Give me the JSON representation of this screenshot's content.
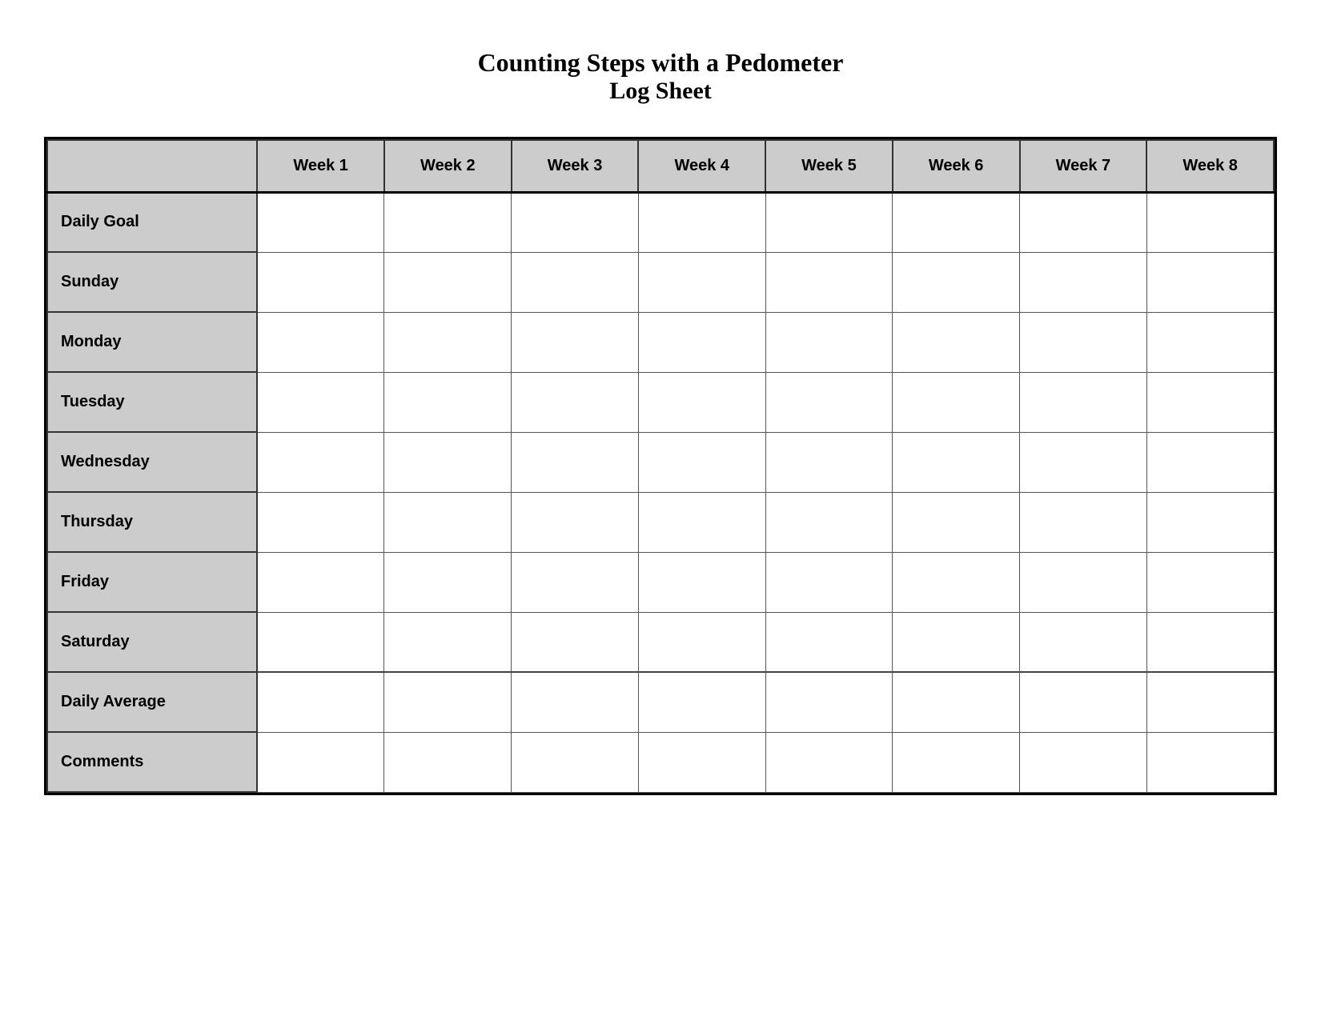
{
  "title": {
    "main": "Counting Steps with a Pedometer",
    "sub": "Log Sheet"
  },
  "header": {
    "corner_label": "",
    "weeks": [
      "Week 1",
      "Week 2",
      "Week 3",
      "Week 4",
      "Week 5",
      "Week 6",
      "Week 7",
      "Week 8"
    ]
  },
  "rows": [
    {
      "label": "Daily Goal"
    },
    {
      "label": "Sunday"
    },
    {
      "label": "Monday"
    },
    {
      "label": "Tuesday"
    },
    {
      "label": "Wednesday"
    },
    {
      "label": "Thursday"
    },
    {
      "label": "Friday"
    },
    {
      "label": "Saturday"
    },
    {
      "label": "Daily Average"
    },
    {
      "label": "Comments"
    }
  ]
}
